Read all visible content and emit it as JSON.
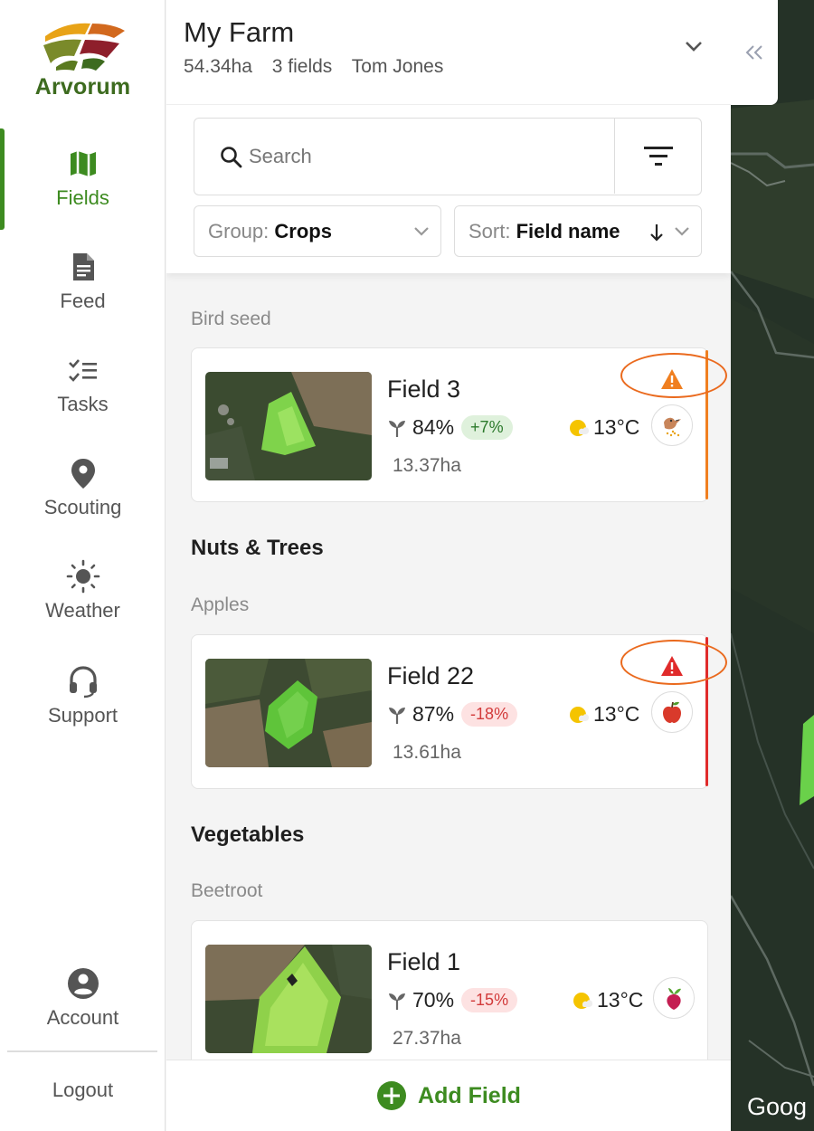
{
  "sidebar": {
    "logo_text": "Arvorum",
    "items": [
      {
        "label": "Fields",
        "icon": "map-icon",
        "active": true
      },
      {
        "label": "Feed",
        "icon": "document-icon"
      },
      {
        "label": "Tasks",
        "icon": "checklist-icon"
      },
      {
        "label": "Scouting",
        "icon": "location-pin-icon"
      },
      {
        "label": "Weather",
        "icon": "sun-icon"
      },
      {
        "label": "Support",
        "icon": "headset-icon"
      }
    ],
    "account_label": "Account",
    "logout_label": "Logout"
  },
  "header": {
    "farm_name": "My Farm",
    "area": "54.34ha",
    "field_count": "3 fields",
    "owner": "Tom Jones"
  },
  "search": {
    "placeholder": "Search"
  },
  "group_select": {
    "prefix": "Group:",
    "value": "Crops"
  },
  "sort_select": {
    "prefix": "Sort:",
    "value": "Field name"
  },
  "groups": [
    {
      "title": "",
      "subgroup": "Bird seed"
    },
    {
      "title": "Nuts & Trees",
      "subgroup": "Apples"
    },
    {
      "title": "Vegetables",
      "subgroup": "Beetroot"
    }
  ],
  "fields": [
    {
      "name": "Field 3",
      "ndvi": "84%",
      "change": "+7%",
      "trend": "up",
      "area": "13.37ha",
      "temp": "13°C",
      "crop_icon": "bird-icon",
      "alert": "warning-orange"
    },
    {
      "name": "Field 22",
      "ndvi": "87%",
      "change": "-18%",
      "trend": "down",
      "area": "13.61ha",
      "temp": "13°C",
      "crop_icon": "apple-icon",
      "alert": "warning-red"
    },
    {
      "name": "Field 1",
      "ndvi": "70%",
      "change": "-15%",
      "trend": "down",
      "area": "27.37ha",
      "temp": "13°C",
      "crop_icon": "beetroot-icon",
      "alert": ""
    }
  ],
  "add_field_label": "Add Field",
  "map": {
    "attribution": "Goog"
  },
  "colors": {
    "brand_green": "#3d8b20",
    "warning_orange": "#f07f20",
    "alert_red": "#e02b2b"
  }
}
